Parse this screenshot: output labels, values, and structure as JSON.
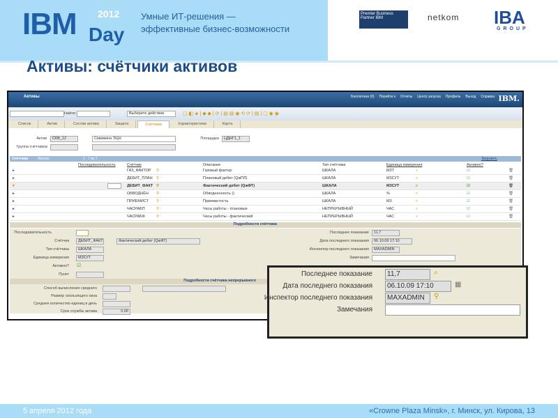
{
  "header": {
    "logo_ibm": "IBM",
    "logo_day": "Day",
    "logo_year": "2012",
    "tagline1": "Умные ИТ-решения —",
    "tagline2": "эффективные бизнес-возможности",
    "partner": "Premier Business Partner IBM",
    "netkom": "netkom",
    "iba": "IBA",
    "iba_group": "GROUP"
  },
  "title": "Активы: счётчики активов",
  "app": {
    "title": "Активы",
    "nav": [
      "Бюллетени (6)",
      "Перейти к",
      "Отчеты",
      "Центр запуска",
      "Профиль",
      "Выход",
      "Справка"
    ],
    "ibm": "IBM.",
    "toolbar": {
      "find_label": "Найти:",
      "action_placeholder": "Выберите действие"
    },
    "tabs": [
      "Список",
      "Актив",
      "Состав актива",
      "Защита",
      "Счётчики",
      "Характеристики",
      "Карта"
    ],
    "active_tab": "Счётчики",
    "form": {
      "asset_label": "Актив",
      "asset_value": "СКВ_12",
      "asset_desc": "Скважина ЭЦН",
      "site_label": "Площадка",
      "site_value": "ЦДНГ1_1",
      "group_label": "Группа счётчиков"
    },
    "table": {
      "title": "Счётчики",
      "filter": "Фильтр",
      "paging": "1 - 7 из 7",
      "download": "Загрузить",
      "columns": [
        "Последовательность",
        "Счётчик",
        "Описание",
        "Тип счётчика",
        "Единица измерения",
        "Активно?"
      ],
      "rows": [
        {
          "counter": "ГАЗ_ФАКТОР",
          "desc": "Газовый фактор",
          "type": "ШКАЛА",
          "unit": "М3Т",
          "selected": false
        },
        {
          "counter": "ДЕБИТ_ПЛАН",
          "desc": "Плановый дебит (QжПЛ)",
          "type": "ШКАЛА",
          "unit": "М3СУТ",
          "selected": false
        },
        {
          "counter": "ДЕБИТ_ФАКТ",
          "desc": "Фактический дебит (QжФТ)",
          "type": "ШКАЛА",
          "unit": "М3СУТ",
          "selected": true
        },
        {
          "counter": "ОБВОДНЁН",
          "desc": "Обводненность ()",
          "type": "ШКАЛА",
          "unit": "%",
          "selected": false
        },
        {
          "counter": "ПРИЕМИСТ",
          "desc": "Приемистость",
          "type": "ШКАЛА",
          "unit": "М3",
          "selected": false
        },
        {
          "counter": "ЧАСРАБП",
          "desc": "Часы работы - плановые",
          "type": "НЕПРЕРЫВНЫЙ",
          "unit": "ЧАС",
          "selected": false
        },
        {
          "counter": "ЧАСРАБФ",
          "desc": "Часы работы - фактический",
          "type": "НЕПРЕРЫВНЫЙ",
          "unit": "ЧАС",
          "selected": false
        }
      ]
    },
    "details": {
      "section": "Подробности счётчика",
      "seq": "Последовательность",
      "counter": "Счётчик",
      "counter_value": "ДЕБИТ_ФАКТ",
      "counter_desc": "Фактический дебит (QжФТ)",
      "type": "Тип счётчика",
      "type_value": "ШКАЛА",
      "unit": "Единица измерения",
      "unit_value": "М3СУТ",
      "active": "Активно?",
      "point": "Пункт",
      "last_reading": "Последнее показание",
      "last_reading_value": "11,7",
      "last_date": "Дата последнего показания",
      "last_date_value": "06.10.09 17:10",
      "inspector": "Инспектор последнего показания",
      "inspector_value": "MAXADMIN",
      "remarks": "Замечания"
    },
    "details2": {
      "section": "Подробности счётчика непрерывного",
      "avg_method": "Способ вычисления среднего",
      "window": "Размер скользящего окна",
      "avg_per_day": "Среднее количество единиц в день",
      "life": "Срок службы актива",
      "life_value": "0,00"
    }
  },
  "footer": {
    "date": "5 апреля 2012 года",
    "place": "«Crowne Plaza Minsk», г. Минск, ул. Кирова, 13"
  }
}
